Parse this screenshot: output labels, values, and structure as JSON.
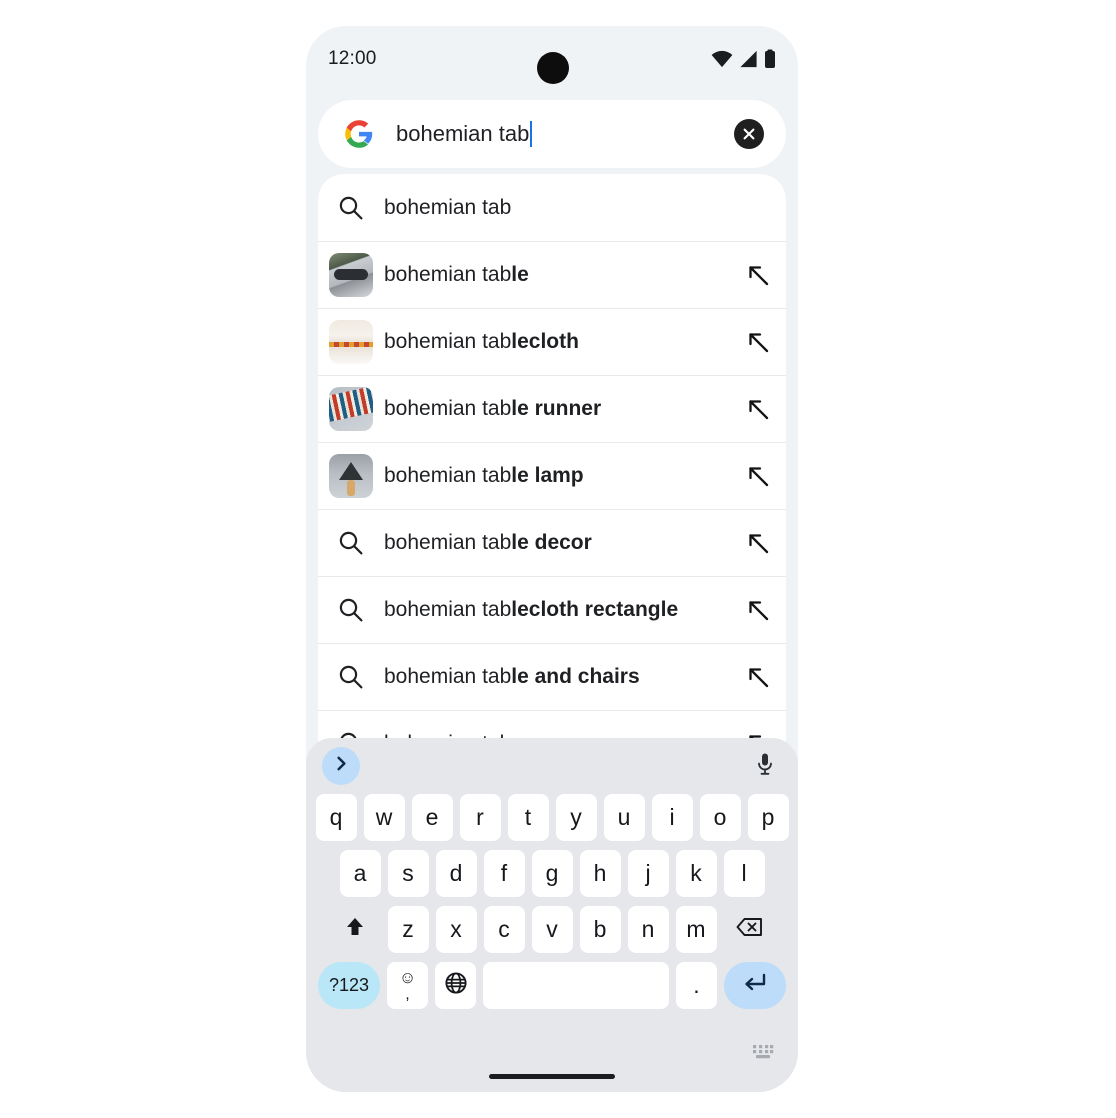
{
  "status_bar": {
    "time": "12:00",
    "icons": [
      "wifi-icon",
      "cellular-signal-icon",
      "battery-icon"
    ]
  },
  "search_bar": {
    "logo": "google-g-logo",
    "query": "bohemian tab",
    "clear_label": "✕",
    "clear_icon": "clear-circle-icon",
    "cursor_visible": true
  },
  "suggestions": {
    "items": [
      {
        "prefix": "bohemian tab",
        "bold": "",
        "lead": "search-icon",
        "thumb": null,
        "arrow": false
      },
      {
        "prefix": "bohemian tab",
        "bold": "le",
        "lead": "thumbnail",
        "thumb": "th-table",
        "arrow": true
      },
      {
        "prefix": "bohemian tab",
        "bold": "lecloth",
        "lead": "thumbnail",
        "thumb": "th-cloth",
        "arrow": true
      },
      {
        "prefix": "bohemian tab",
        "bold": "le runner",
        "lead": "thumbnail",
        "thumb": "th-runner",
        "arrow": true
      },
      {
        "prefix": "bohemian tab",
        "bold": "le lamp",
        "lead": "thumbnail",
        "thumb": "th-lamp",
        "arrow": true
      },
      {
        "prefix": "bohemian tab",
        "bold": "le decor",
        "lead": "search-icon",
        "thumb": null,
        "arrow": true
      },
      {
        "prefix": "bohemian tab",
        "bold": "lecloth rectangle",
        "lead": "search-icon",
        "thumb": null,
        "arrow": true
      },
      {
        "prefix": "bohemian tab",
        "bold": "le and chairs",
        "lead": "search-icon",
        "thumb": null,
        "arrow": true
      },
      {
        "prefix": "bohemian tab",
        "bold": "s",
        "lead": "search-icon",
        "thumb": null,
        "arrow": true
      }
    ]
  },
  "keyboard": {
    "toolbar": {
      "expand_icon": "chevron-right-icon",
      "mic_icon": "microphone-icon"
    },
    "row1": [
      "q",
      "w",
      "e",
      "r",
      "t",
      "y",
      "u",
      "i",
      "o",
      "p"
    ],
    "row2": [
      "a",
      "s",
      "d",
      "f",
      "g",
      "h",
      "j",
      "k",
      "l"
    ],
    "row3_letters": [
      "z",
      "x",
      "c",
      "v",
      "b",
      "n",
      "m"
    ],
    "shift_icon": "shift-up-arrow-icon",
    "backspace_icon": "backspace-delete-icon",
    "symbols_label": "?123",
    "emoji_glyph": "☺",
    "comma_glyph": ",",
    "globe_icon": "globe-language-icon",
    "space_label": "",
    "period_label": ".",
    "enter_icon": "enter-return-icon",
    "switcher_icon": "keyboard-switcher-icon"
  },
  "colors": {
    "phone_bg": "#eff3f6",
    "panel_bg": "#ffffff",
    "keyboard_bg": "#e5e7ea",
    "key_bg": "#ffffff",
    "accent_cyan": "#b9e7f7",
    "accent_blue": "#bcdcfa",
    "cursor_blue": "#1a73e8",
    "text": "#1f2023"
  }
}
